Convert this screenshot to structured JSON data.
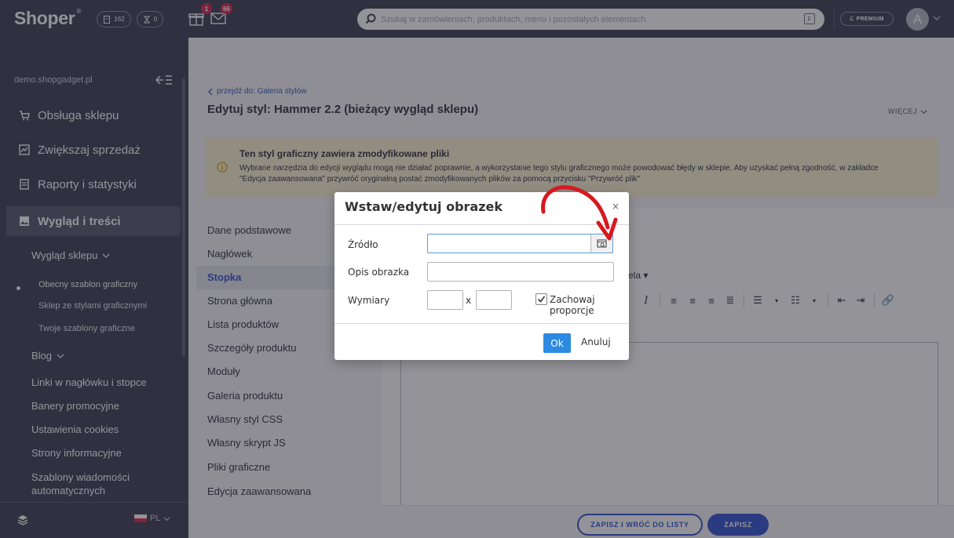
{
  "topbar": {
    "logo": "Shoper",
    "logo_mark": "®",
    "orders_count": "162",
    "pending_count": "0",
    "gift_badge": "1",
    "mail_badge": "66",
    "search_placeholder": "Szukaj w zamówieniach, produktach, menu i pozostałych elementach",
    "search_shortcut": "F",
    "premium_label": "PREMIUM",
    "avatar_letter": "A"
  },
  "sidebar": {
    "domain": "demo.shopgadget.pl",
    "main_items": [
      {
        "label": "Obsługa sklepu",
        "icon": "cart-icon"
      },
      {
        "label": "Zwiększaj sprzedaż",
        "icon": "chart-icon"
      },
      {
        "label": "Raporty i statystyki",
        "icon": "report-icon"
      },
      {
        "label": "Wygląd i treści",
        "icon": "image-icon"
      }
    ],
    "sub_items": [
      "Wygląd sklepu",
      "Obecny szablon graficzny",
      "Sklep ze stylami graficznymi",
      "Twoje szablony graficzne",
      "Blog",
      "Linki w nagłówku i stopce",
      "Banery promocyjne",
      "Ustawienia cookies",
      "Strony informacyjne",
      "Szablony wiadomości automatycznych"
    ],
    "language": "PL"
  },
  "content": {
    "back_link": "przejdź do: Galeria stylów",
    "page_title": "Edytuj styl: Hammer 2.2 (bieżący wygląd sklepu)",
    "more_label": "WIĘCEJ",
    "alert": {
      "title": "Ten styl graficzny zawiera zmodyfikowane pliki",
      "text": "Wybrane narzędzia do edycji wyglądu mogą nie działać poprawnie, a wykorzystanie tego stylu graficznego może powodować błędy w sklepie. Aby uzyskać pełną zgodność, w zakładce \"Edycja zaawansowana\" przywróć oryginalną postać zmodyfikowanych plików za pomocą przycisku \"Przywróć plik\""
    },
    "left_menu": [
      "Dane podstawowe",
      "Nagłówek",
      "Stopka",
      "Strona główna",
      "Lista produktów",
      "Szczegóły produktu",
      "Moduły",
      "Galeria produktu",
      "Własny styl CSS",
      "Własny skrypt JS",
      "Pliki graficzne",
      "Edycja zaawansowana"
    ],
    "editor_font_label": "ela",
    "save_return_label": "ZAPISZ I WRÓĆ DO LISTY",
    "save_label": "ZAPISZ"
  },
  "dialog": {
    "title": "Wstaw/edytuj obrazek",
    "close": "×",
    "source_label": "Źródło",
    "source_value": "",
    "alt_label": "Opis obrazka",
    "alt_value": "",
    "dims_label": "Wymiary",
    "width_value": "",
    "times": "x",
    "height_value": "",
    "keep_ratio_label": "Zachowaj proporcje",
    "keep_ratio_checked": true,
    "ok_label": "Ok",
    "cancel_label": "Anuluj"
  },
  "colors": {
    "sidebar_bg": "#3b3950",
    "accent_blue": "#2f4fd0",
    "ok_blue": "#2d8ae1",
    "badge_red": "#d8214a",
    "alert_bg": "#fbf2d0",
    "annotation_red": "#d71920"
  }
}
